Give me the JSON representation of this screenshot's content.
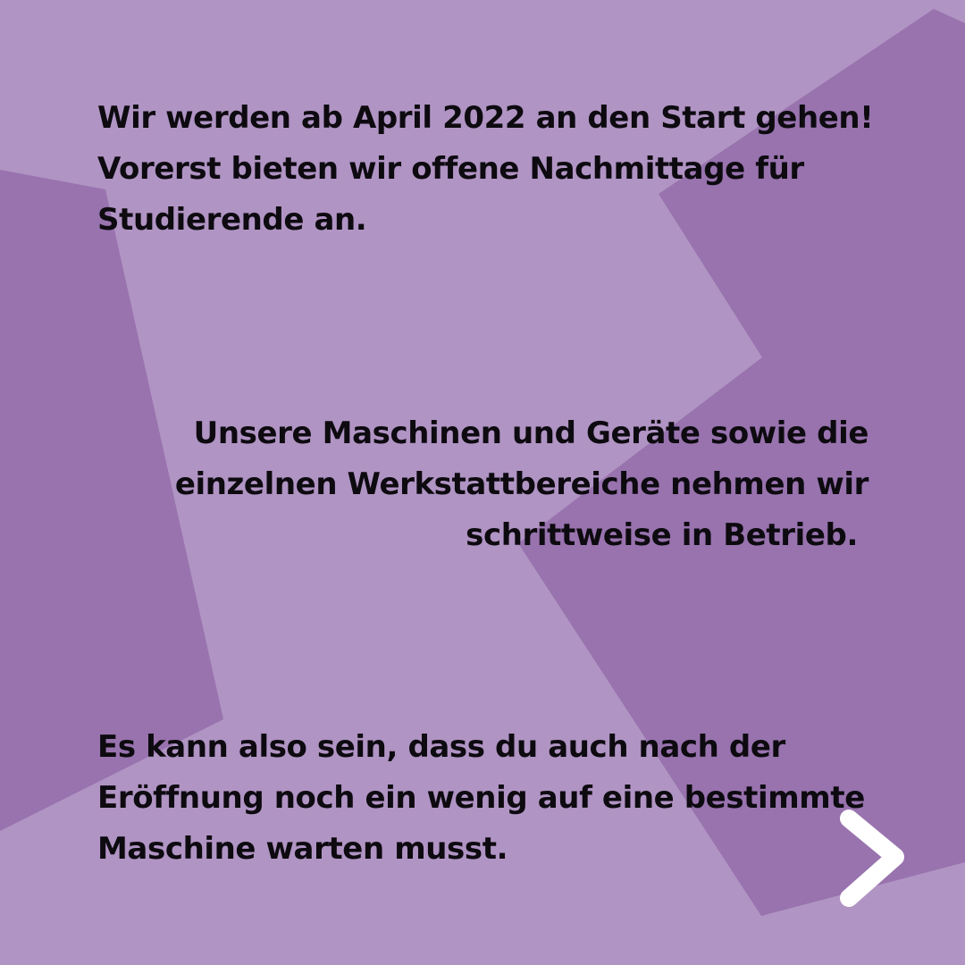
{
  "colors": {
    "background": "#b094c3",
    "shape": "#9873ae",
    "text": "#0d0a10",
    "arrow": "#ffffff"
  },
  "blocks": [
    {
      "lines": [
        "Wir werden ab April 2022 an den Start gehen!",
        "Vorerst bieten wir offene Nachmittage für",
        "Studierende an."
      ]
    },
    {
      "lines": [
        "Unsere Maschinen und Geräte sowie die",
        "einzelnen Werkstattbereiche nehmen wir",
        "schrittweise in Betrieb."
      ]
    },
    {
      "lines": [
        "Es kann also sein, dass du auch nach der",
        "Eröffnung noch ein wenig auf eine bestimmte",
        "Maschine warten musst."
      ]
    }
  ],
  "next_icon": "chevron-right-icon"
}
